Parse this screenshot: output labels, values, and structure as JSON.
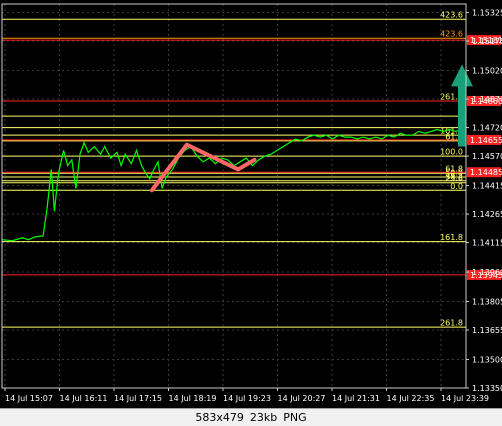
{
  "footer": {
    "dimensions": "583x479",
    "size": "23kb",
    "format": "PNG"
  },
  "colors": {
    "background": "#000000",
    "price_line": "#00ff00",
    "grid": "#3a3a3a",
    "fib_upper": "#ff9900",
    "fib_lower": "#ffff66",
    "level_red": "#ff2222",
    "zigzag": "#ff6666",
    "arrow": "#1aa07a"
  },
  "chart_data": {
    "type": "line",
    "symbol_axis": "price",
    "ylim": [
      1.1335,
      1.1537
    ],
    "price_ticks": [
      "1.15325",
      "1.15175",
      "1.15020",
      "1.14870",
      "1.14720",
      "1.14570",
      "1.14415",
      "1.14265",
      "1.14115",
      "1.13960",
      "1.13805",
      "1.13655",
      "1.13500",
      "1.13350"
    ],
    "time_ticks": [
      "14 Jul 15:07",
      "14 Jul 16:11",
      "14 Jul 17:15",
      "14 Jul 18:19",
      "14 Jul 19:23",
      "14 Jul 20:27",
      "14 Jul 21:31",
      "14 Jul 22:35",
      "14 Jul 23:39"
    ],
    "price_tags": [
      {
        "price": 1.1518,
        "text": "1.15181"
      },
      {
        "price": 1.1486,
        "text": "1.14860"
      },
      {
        "price": 1.14655,
        "text": "1.14655"
      },
      {
        "price": 1.14485,
        "text": "1.14485"
      },
      {
        "price": 1.13945,
        "text": "1.13945"
      }
    ],
    "fib_levels": [
      {
        "price": 1.1529,
        "label": "423.6",
        "color": "#ffff66",
        "x_from": 0.0
      },
      {
        "price": 1.1519,
        "label": "423.6",
        "color": "#ff9900",
        "x_from": 0.0
      },
      {
        "price": 1.1486,
        "label": "261.8",
        "color": "#ffff66",
        "x_from": 0.0
      },
      {
        "price": 1.1478,
        "label": "2",
        "color": "#ffff66",
        "x_from": 0.0
      },
      {
        "price": 1.1472,
        "label": "1",
        "color": "#ffff66",
        "x_from": 0.0
      },
      {
        "price": 1.1468,
        "label": "161.8",
        "color": "#ffff66",
        "x_from": 0.0
      },
      {
        "price": 1.1465,
        "label": "61.8",
        "color": "#ffff66",
        "x_from": 0.0
      },
      {
        "price": 1.1457,
        "label": "100.0",
        "color": "#ffff66",
        "x_from": 0.0
      },
      {
        "price": 1.1448,
        "label": "61.8",
        "color": "#ffff66",
        "x_from": 0.0
      },
      {
        "price": 1.1446,
        "label": "50.0",
        "color": "#ffff66",
        "x_from": 0.0
      },
      {
        "price": 1.1444,
        "label": "38.2",
        "color": "#ffff66",
        "x_from": 0.0
      },
      {
        "price": 1.1443,
        "label": "23.6",
        "color": "#ffff66",
        "x_from": 0.0
      },
      {
        "price": 1.1439,
        "label": "0.0",
        "color": "#ffff66",
        "x_from": 0.0
      },
      {
        "price": 1.1412,
        "label": "161.8",
        "color": "#ffff66",
        "x_from": 0.0
      },
      {
        "price": 1.1367,
        "label": "261.8",
        "color": "#ffff66",
        "x_from": 0.0
      }
    ],
    "close_series": [
      {
        "t": 0.0,
        "p": 1.1413
      },
      {
        "t": 0.5,
        "p": 1.14125
      },
      {
        "t": 1.0,
        "p": 1.1414
      },
      {
        "t": 1.3,
        "p": 1.1413
      },
      {
        "t": 1.6,
        "p": 1.14145
      },
      {
        "t": 2.0,
        "p": 1.1415
      },
      {
        "t": 2.2,
        "p": 1.143
      },
      {
        "t": 2.4,
        "p": 1.145
      },
      {
        "t": 2.55,
        "p": 1.1428
      },
      {
        "t": 2.75,
        "p": 1.1448
      },
      {
        "t": 3.0,
        "p": 1.146
      },
      {
        "t": 3.2,
        "p": 1.1452
      },
      {
        "t": 3.4,
        "p": 1.1455
      },
      {
        "t": 3.6,
        "p": 1.144
      },
      {
        "t": 3.8,
        "p": 1.1458
      },
      {
        "t": 4.0,
        "p": 1.1464
      },
      {
        "t": 4.2,
        "p": 1.1459
      },
      {
        "t": 4.5,
        "p": 1.1462
      },
      {
        "t": 4.8,
        "p": 1.1458
      },
      {
        "t": 5.0,
        "p": 1.1462
      },
      {
        "t": 5.3,
        "p": 1.1456
      },
      {
        "t": 5.6,
        "p": 1.1459
      },
      {
        "t": 5.8,
        "p": 1.1452
      },
      {
        "t": 6.0,
        "p": 1.1458
      },
      {
        "t": 6.3,
        "p": 1.1453
      },
      {
        "t": 6.55,
        "p": 1.146
      },
      {
        "t": 6.8,
        "p": 1.1452
      },
      {
        "t": 7.0,
        "p": 1.1448
      },
      {
        "t": 7.2,
        "p": 1.1445
      },
      {
        "t": 7.4,
        "p": 1.145
      },
      {
        "t": 7.6,
        "p": 1.1454
      },
      {
        "t": 7.8,
        "p": 1.144
      },
      {
        "t": 8.0,
        "p": 1.1446
      },
      {
        "t": 8.3,
        "p": 1.145
      },
      {
        "t": 8.6,
        "p": 1.1456
      },
      {
        "t": 8.9,
        "p": 1.146
      },
      {
        "t": 9.2,
        "p": 1.1462
      },
      {
        "t": 9.5,
        "p": 1.1457
      },
      {
        "t": 9.8,
        "p": 1.1454
      },
      {
        "t": 10.1,
        "p": 1.1456
      },
      {
        "t": 10.4,
        "p": 1.1453
      },
      {
        "t": 10.7,
        "p": 1.1456
      },
      {
        "t": 11.0,
        "p": 1.1455
      },
      {
        "t": 11.3,
        "p": 1.1452
      },
      {
        "t": 11.6,
        "p": 1.1454
      },
      {
        "t": 11.9,
        "p": 1.1456
      },
      {
        "t": 12.2,
        "p": 1.1452
      },
      {
        "t": 12.5,
        "p": 1.1455
      },
      {
        "t": 12.8,
        "p": 1.1457
      },
      {
        "t": 13.1,
        "p": 1.1458
      },
      {
        "t": 13.4,
        "p": 1.146
      },
      {
        "t": 13.7,
        "p": 1.1462
      },
      {
        "t": 14.0,
        "p": 1.1464
      },
      {
        "t": 14.3,
        "p": 1.1466
      },
      {
        "t": 14.6,
        "p": 1.1465
      },
      {
        "t": 14.9,
        "p": 1.1467
      },
      {
        "t": 15.2,
        "p": 1.1468
      },
      {
        "t": 15.5,
        "p": 1.1467
      },
      {
        "t": 15.8,
        "p": 1.1468
      },
      {
        "t": 16.1,
        "p": 1.1466
      },
      {
        "t": 16.4,
        "p": 1.1468
      },
      {
        "t": 16.7,
        "p": 1.1467
      },
      {
        "t": 17.0,
        "p": 1.1467
      },
      {
        "t": 17.3,
        "p": 1.1466
      },
      {
        "t": 17.6,
        "p": 1.1467
      },
      {
        "t": 17.9,
        "p": 1.1466
      },
      {
        "t": 18.2,
        "p": 1.1467
      },
      {
        "t": 18.5,
        "p": 1.1466
      },
      {
        "t": 18.8,
        "p": 1.1468
      },
      {
        "t": 19.1,
        "p": 1.1467
      },
      {
        "t": 19.4,
        "p": 1.1469
      },
      {
        "t": 19.7,
        "p": 1.1468
      },
      {
        "t": 20.0,
        "p": 1.1468
      },
      {
        "t": 20.3,
        "p": 1.147
      },
      {
        "t": 20.6,
        "p": 1.1469
      },
      {
        "t": 20.9,
        "p": 1.147
      },
      {
        "t": 21.2,
        "p": 1.1471
      },
      {
        "t": 21.5,
        "p": 1.147
      },
      {
        "t": 21.8,
        "p": 1.1471
      },
      {
        "t": 22.1,
        "p": 1.147
      },
      {
        "t": 22.4,
        "p": 1.1471
      }
    ],
    "time_span": 22.6,
    "zigzag": [
      {
        "t": 7.3,
        "p": 1.1439
      },
      {
        "t": 9.0,
        "p": 1.1463
      },
      {
        "t": 11.5,
        "p": 1.145
      },
      {
        "t": 12.3,
        "p": 1.1455
      }
    ],
    "arrow_target": {
      "t": 22.6,
      "p": 1.15
    },
    "arrow_from": {
      "t": 22.6,
      "p": 1.1462
    },
    "grid": true
  }
}
